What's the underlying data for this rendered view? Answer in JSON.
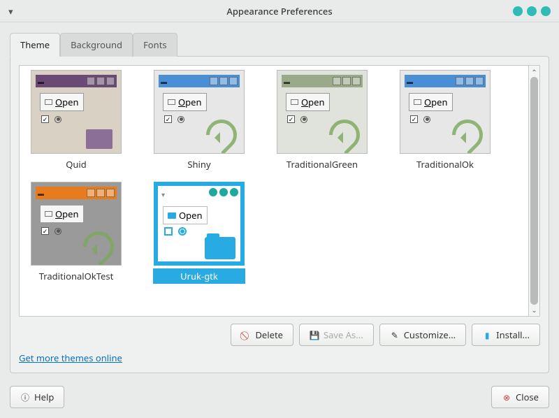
{
  "window": {
    "title": "Appearance Preferences"
  },
  "tabs": [
    {
      "label": "Theme",
      "active": true
    },
    {
      "label": "Background",
      "active": false
    },
    {
      "label": "Fonts",
      "active": false
    }
  ],
  "themes": [
    {
      "name": "Quid",
      "open_label": "Open",
      "tbar_color": "#6a4a74",
      "body_color": "#d9d1c4",
      "accent": "#8c6f96",
      "folder": true,
      "swirl": false,
      "selected": false
    },
    {
      "name": "Shiny",
      "open_label": "Open",
      "tbar_color": "#4a8fd6",
      "body_color": "#e7e7e7",
      "accent": "#7aa85a",
      "folder": false,
      "swirl": true,
      "selected": false
    },
    {
      "name": "TraditionalGreen",
      "open_label": "Open",
      "tbar_color": "#9aa989",
      "body_color": "#e0e3dc",
      "accent": "#7aa85a",
      "folder": false,
      "swirl": true,
      "selected": false
    },
    {
      "name": "TraditionalOk",
      "open_label": "Open",
      "tbar_color": "#4a8fd6",
      "body_color": "#e7e7e7",
      "accent": "#7aa85a",
      "folder": false,
      "swirl": true,
      "selected": false
    },
    {
      "name": "TraditionalOkTest",
      "open_label": "Open",
      "tbar_color": "#e87b1c",
      "body_color": "#9a9a9a",
      "accent": "#7aa85a",
      "folder": false,
      "swirl": true,
      "selected": false
    },
    {
      "name": "Uruk-gtk",
      "open_label": "Open",
      "tbar_color": "#ffffff",
      "body_color": "#ffffff",
      "accent": "#28abe3",
      "folder": false,
      "swirl": false,
      "selected": true,
      "uruk": true
    }
  ],
  "actions": {
    "delete": "Delete",
    "save_as": "Save As...",
    "customize": "Customize...",
    "install": "Install..."
  },
  "link": "Get more themes online",
  "footer": {
    "help": "Help",
    "close": "Close"
  }
}
